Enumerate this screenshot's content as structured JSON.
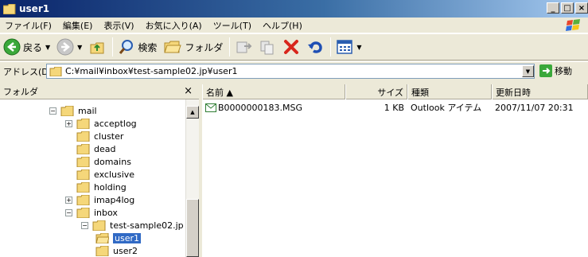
{
  "window": {
    "title": "user1"
  },
  "menu": {
    "items": [
      "ファイル(F)",
      "編集(E)",
      "表示(V)",
      "お気に入り(A)",
      "ツール(T)",
      "ヘルプ(H)"
    ]
  },
  "toolbar": {
    "back_label": "戻る",
    "search_label": "検索",
    "folders_label": "フォルダ"
  },
  "address": {
    "label": "アドレス(D)",
    "path": "C:¥mail¥inbox¥test-sample02.jp¥user1",
    "go_label": "移動"
  },
  "folders_pane": {
    "title": "フォルダ",
    "close_glyph": "×",
    "tree": [
      {
        "label": "mail",
        "expander": "−"
      },
      {
        "label": "acceptlog",
        "expander": "+"
      },
      {
        "label": "cluster",
        "expander": ""
      },
      {
        "label": "dead",
        "expander": ""
      },
      {
        "label": "domains",
        "expander": ""
      },
      {
        "label": "exclusive",
        "expander": ""
      },
      {
        "label": "holding",
        "expander": ""
      },
      {
        "label": "imap4log",
        "expander": "+"
      },
      {
        "label": "inbox",
        "expander": "−"
      },
      {
        "label": "test-sample02.jp",
        "expander": "−"
      },
      {
        "label": "user1",
        "expander": "",
        "selected": true
      },
      {
        "label": "user2",
        "expander": ""
      }
    ]
  },
  "files_pane": {
    "columns": [
      "名前 ▲",
      "サイズ",
      "種類",
      "更新日時"
    ],
    "rows": [
      {
        "name": "B0000000183.MSG",
        "size": "1 KB",
        "type": "Outlook アイテム",
        "modified": "2007/11/07 20:31"
      }
    ]
  },
  "colors": {
    "title_bar_start": "#0a246a",
    "selection": "#316ac5",
    "chrome": "#ece9d8"
  }
}
